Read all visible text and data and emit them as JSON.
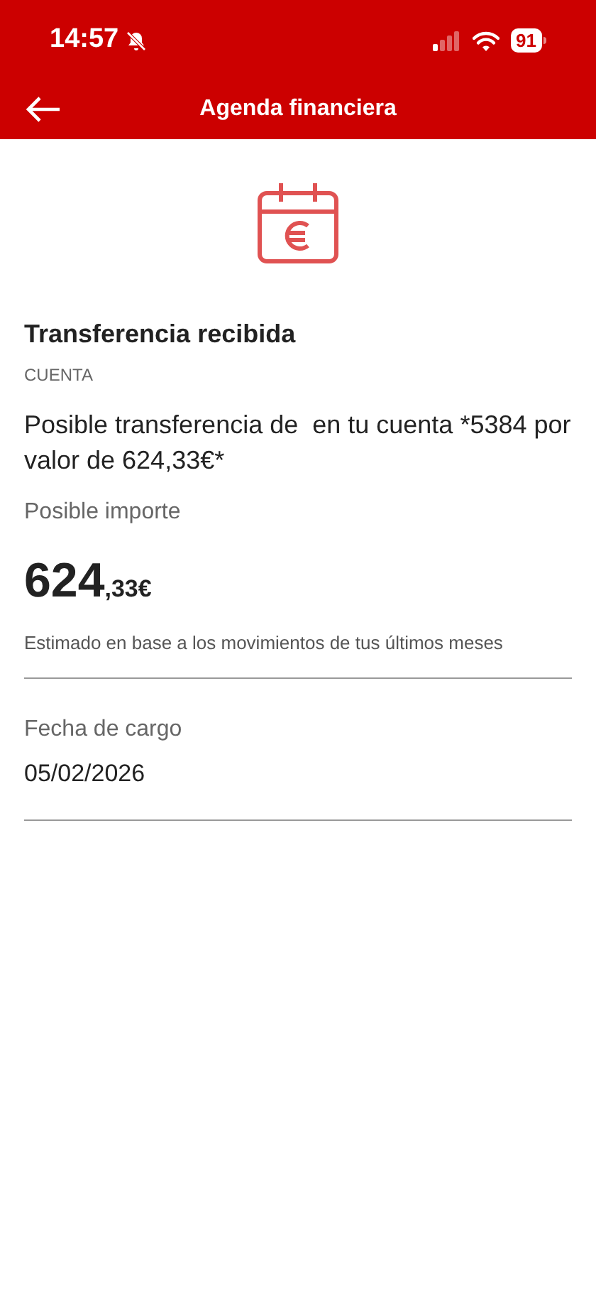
{
  "status_bar": {
    "time": "14:57",
    "battery": "91"
  },
  "header": {
    "title": "Agenda financiera"
  },
  "event": {
    "title": "Transferencia recibida",
    "category": "CUENTA",
    "description": "Posible transferencia de  en tu cuenta *5384 por valor de 624,33€*",
    "amount_label": "Posible importe",
    "amount_integer": "624",
    "amount_decimal": ",33€",
    "amount_note": "Estimado en base a los movimientos de tus últimos meses"
  },
  "fields": [
    {
      "label": "Fecha de cargo",
      "value": "05/02/2026"
    }
  ]
}
